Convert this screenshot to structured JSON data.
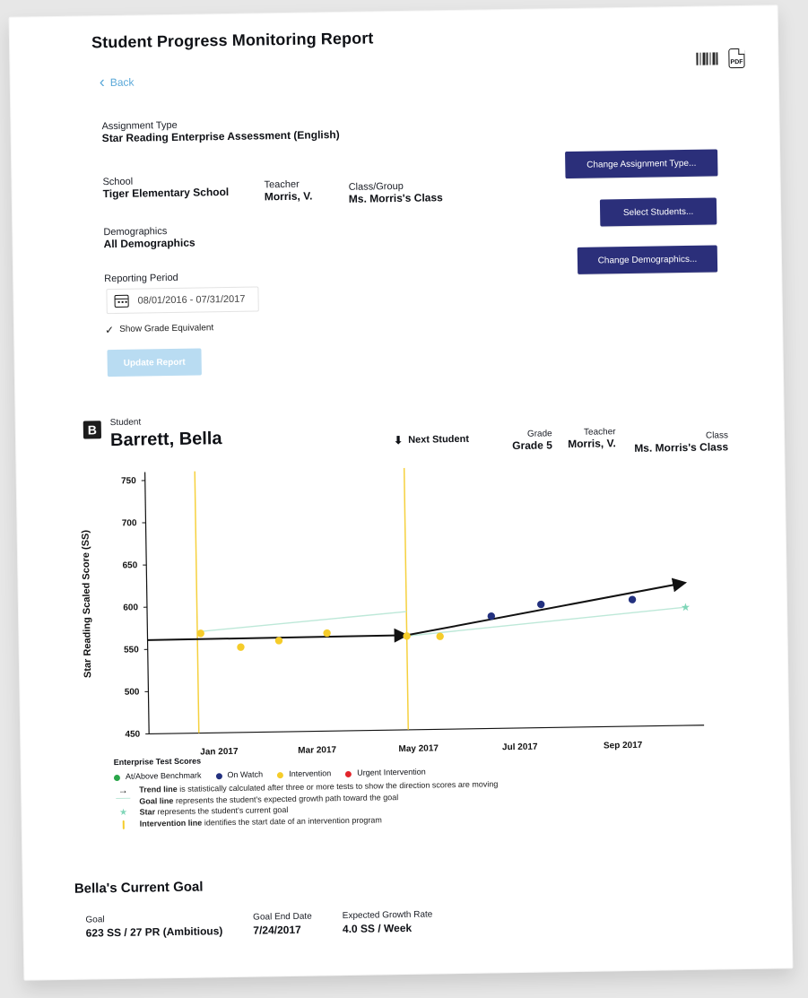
{
  "header": {
    "title": "Student Progress Monitoring Report",
    "back_label": "Back"
  },
  "fields": {
    "assignment_type_label": "Assignment Type",
    "assignment_type_value": "Star Reading Enterprise Assessment (English)",
    "school_label": "School",
    "school_value": "Tiger Elementary School",
    "teacher_label": "Teacher",
    "teacher_value": "Morris, V.",
    "class_group_label": "Class/Group",
    "class_group_value": "Ms. Morris's Class",
    "demographics_label": "Demographics",
    "demographics_value": "All Demographics",
    "reporting_period_label": "Reporting Period",
    "reporting_period_value": "08/01/2016 - 07/31/2017",
    "show_grade_equivalent_label": "Show Grade Equivalent"
  },
  "buttons": {
    "change_assignment_type": "Change Assignment Type...",
    "select_students": "Select Students...",
    "change_demographics": "Change Demographics...",
    "update_report": "Update Report"
  },
  "student": {
    "section_badge": "B",
    "student_label": "Student",
    "student_name": "Barrett, Bella",
    "next_student": "Next Student",
    "grade_label": "Grade",
    "grade_value": "Grade 5",
    "teacher_label": "Teacher",
    "teacher_value": "Morris, V.",
    "class_label": "Class",
    "class_value": "Ms. Morris's Class"
  },
  "chart_data": {
    "type": "scatter",
    "ylabel": "Star Reading Scaled Score (SS)",
    "yticks": [
      750,
      700,
      650,
      600,
      550,
      500,
      450
    ],
    "xticks": [
      "Jan 2017",
      "Mar 2017",
      "May 2017",
      "Jul 2017",
      "Sep 2017"
    ],
    "ylim": [
      450,
      760
    ],
    "points": [
      {
        "x": "2016-12-22",
        "y": 568,
        "status": "Intervention"
      },
      {
        "x": "2017-01-15",
        "y": 551,
        "status": "Intervention"
      },
      {
        "x": "2017-02-07",
        "y": 558,
        "status": "Intervention"
      },
      {
        "x": "2017-03-08",
        "y": 566,
        "status": "Intervention"
      },
      {
        "x": "2017-04-25",
        "y": 561,
        "status": "Intervention"
      },
      {
        "x": "2017-05-15",
        "y": 560,
        "status": "Intervention"
      },
      {
        "x": "2017-06-15",
        "y": 583,
        "status": "On Watch"
      },
      {
        "x": "2017-07-15",
        "y": 596,
        "status": "On Watch"
      },
      {
        "x": "2017-09-08",
        "y": 600,
        "status": "On Watch"
      }
    ],
    "intervention_lines": [
      "2016-12-20",
      "2017-04-25"
    ],
    "trend_lines": [
      {
        "x": [
          "2016-11-20",
          "2017-04-25"
        ],
        "y": [
          561,
          562
        ]
      },
      {
        "x": [
          "2017-04-25",
          "2017-10-10"
        ],
        "y": [
          562,
          619
        ]
      }
    ],
    "goal_lines": [
      {
        "x": [
          "2016-12-20",
          "2017-04-25"
        ],
        "y": [
          570,
          590
        ]
      },
      {
        "x": [
          "2017-04-25",
          "2017-10-10"
        ],
        "y": [
          561,
          590
        ]
      }
    ],
    "goal_star": {
      "x": "2017-10-10",
      "y": 590
    }
  },
  "legend": {
    "title": "Enterprise Test Scores",
    "items": [
      {
        "label": "At/Above Benchmark",
        "color": "#2aa64a"
      },
      {
        "label": "On Watch",
        "color": "#23317f"
      },
      {
        "label": "Intervention",
        "color": "#f5cc2a"
      },
      {
        "label": "Urgent Intervention",
        "color": "#e2252b"
      }
    ],
    "trend_line_label": "Trend line",
    "trend_line_text": "is statistically calculated after three or more tests to show the direction scores are moving",
    "goal_line_label": "Goal line",
    "goal_line_text": "represents the student's expected growth path toward the goal",
    "star_label": "Star",
    "star_text": "represents the student's current goal",
    "intervention_line_label": "Intervention line",
    "intervention_line_text": "identifies the start date of an intervention program"
  },
  "goal": {
    "title": "Bella's Current Goal",
    "goal_label": "Goal",
    "goal_value": "623 SS / 27 PR (Ambitious)",
    "end_date_label": "Goal End Date",
    "end_date_value": "7/24/2017",
    "growth_rate_label": "Expected Growth Rate",
    "growth_rate_value": "4.0 SS / Week"
  }
}
